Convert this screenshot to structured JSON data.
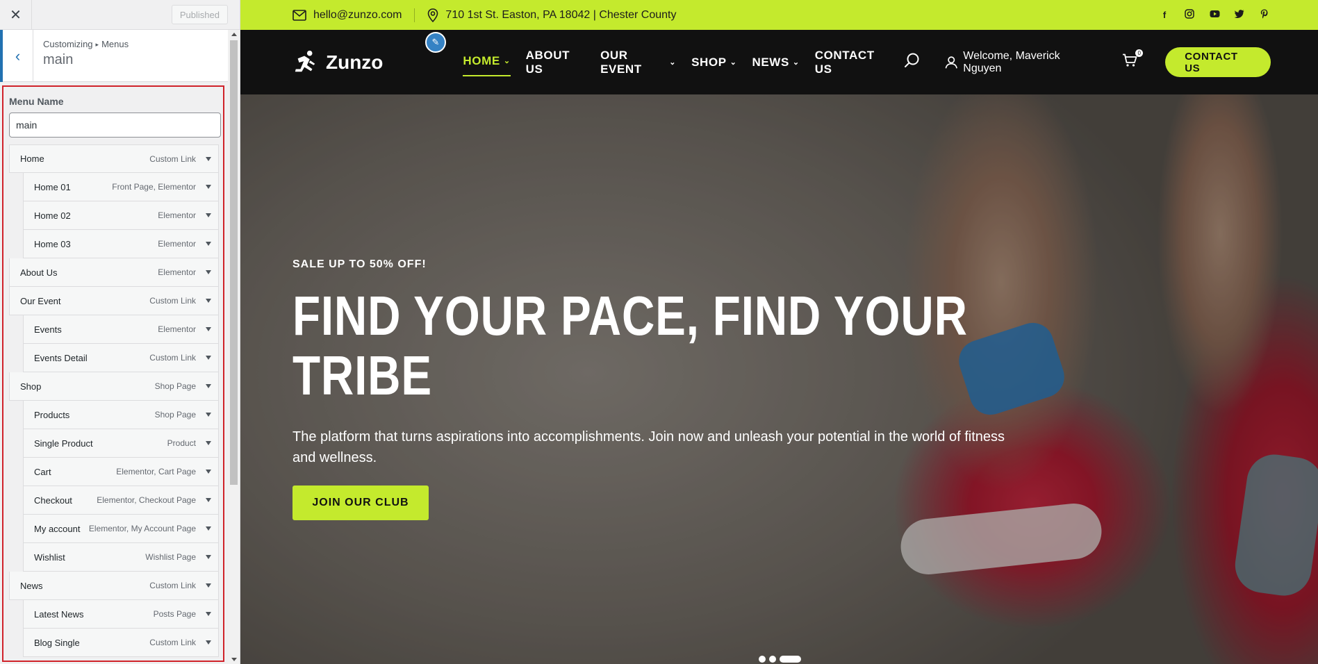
{
  "sidebar": {
    "close_icon": "close-icon",
    "published_label": "Published",
    "breadcrumb_root": "Customizing",
    "breadcrumb_leaf": "Menus",
    "title": "main",
    "menu_name_label": "Menu Name",
    "menu_name_value": "main",
    "items": [
      {
        "title": "Home",
        "type": "Custom Link",
        "depth": 0
      },
      {
        "title": "Home 01",
        "type": "Front Page, Elementor",
        "depth": 1
      },
      {
        "title": "Home 02",
        "type": "Elementor",
        "depth": 1
      },
      {
        "title": "Home 03",
        "type": "Elementor",
        "depth": 1
      },
      {
        "title": "About Us",
        "type": "Elementor",
        "depth": 0
      },
      {
        "title": "Our Event",
        "type": "Custom Link",
        "depth": 0
      },
      {
        "title": "Events",
        "type": "Elementor",
        "depth": 1
      },
      {
        "title": "Events Detail",
        "type": "Custom Link",
        "depth": 1
      },
      {
        "title": "Shop",
        "type": "Shop Page",
        "depth": 0
      },
      {
        "title": "Products",
        "type": "Shop Page",
        "depth": 1
      },
      {
        "title": "Single Product",
        "type": "Product",
        "depth": 1
      },
      {
        "title": "Cart",
        "type": "Elementor, Cart Page",
        "depth": 1
      },
      {
        "title": "Checkout",
        "type": "Elementor, Checkout Page",
        "depth": 1
      },
      {
        "title": "My account",
        "type": "Elementor, My Account Page",
        "depth": 1
      },
      {
        "title": "Wishlist",
        "type": "Wishlist Page",
        "depth": 1
      },
      {
        "title": "News",
        "type": "Custom Link",
        "depth": 0
      },
      {
        "title": "Latest News",
        "type": "Posts Page",
        "depth": 1
      },
      {
        "title": "Blog Single",
        "type": "Custom Link",
        "depth": 1
      }
    ]
  },
  "preview": {
    "topbar": {
      "email": "hello@zunzo.com",
      "address": "710 1st St. Easton, PA 18042 | Chester County",
      "social": [
        "facebook-icon",
        "instagram-icon",
        "youtube-icon",
        "twitter-icon",
        "pinterest-icon"
      ]
    },
    "nav": {
      "logo_text": "Zunzo",
      "items": [
        {
          "label": "HOME",
          "caret": true,
          "active": true
        },
        {
          "label": "ABOUT US",
          "caret": false,
          "active": false
        },
        {
          "label": "OUR EVENT",
          "caret": true,
          "active": false
        },
        {
          "label": "SHOP",
          "caret": true,
          "active": false
        },
        {
          "label": "NEWS",
          "caret": true,
          "active": false
        },
        {
          "label": "CONTACT US",
          "caret": false,
          "active": false
        }
      ],
      "welcome": "Welcome, Maverick Nguyen",
      "cart_count": "0",
      "contact_button": "CONTACT US"
    },
    "hero": {
      "sale": "SALE UP TO 50% OFF!",
      "headline_line1": "FIND YOUR PACE, FIND YOUR",
      "headline_line2": "TRIBE",
      "subtitle": "The platform that turns aspirations into accomplishments. Join now and unleash your potential in the world of fitness and wellness.",
      "cta": "JOIN OUR CLUB"
    },
    "slider": {
      "count": 3,
      "active_index": 2
    }
  },
  "colors": {
    "accent": "#c4ea2d",
    "nav_bg": "#111111",
    "sidebar_bg": "#f0f0f1",
    "highlight_border": "#d0222a",
    "wp_blue": "#2271b1"
  }
}
